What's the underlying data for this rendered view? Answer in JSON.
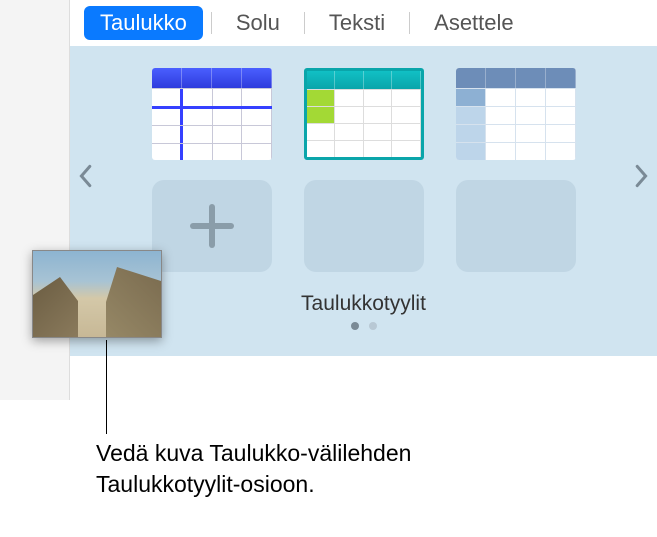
{
  "tabs": {
    "table": "Taulukko",
    "cell": "Solu",
    "text": "Teksti",
    "arrange": "Asettele"
  },
  "styles": {
    "sectionLabel": "Taulukkotyylit"
  },
  "callout": {
    "line1": "Vedä kuva Taulukko-välilehden",
    "line2": "Taulukkotyylit-osioon."
  }
}
